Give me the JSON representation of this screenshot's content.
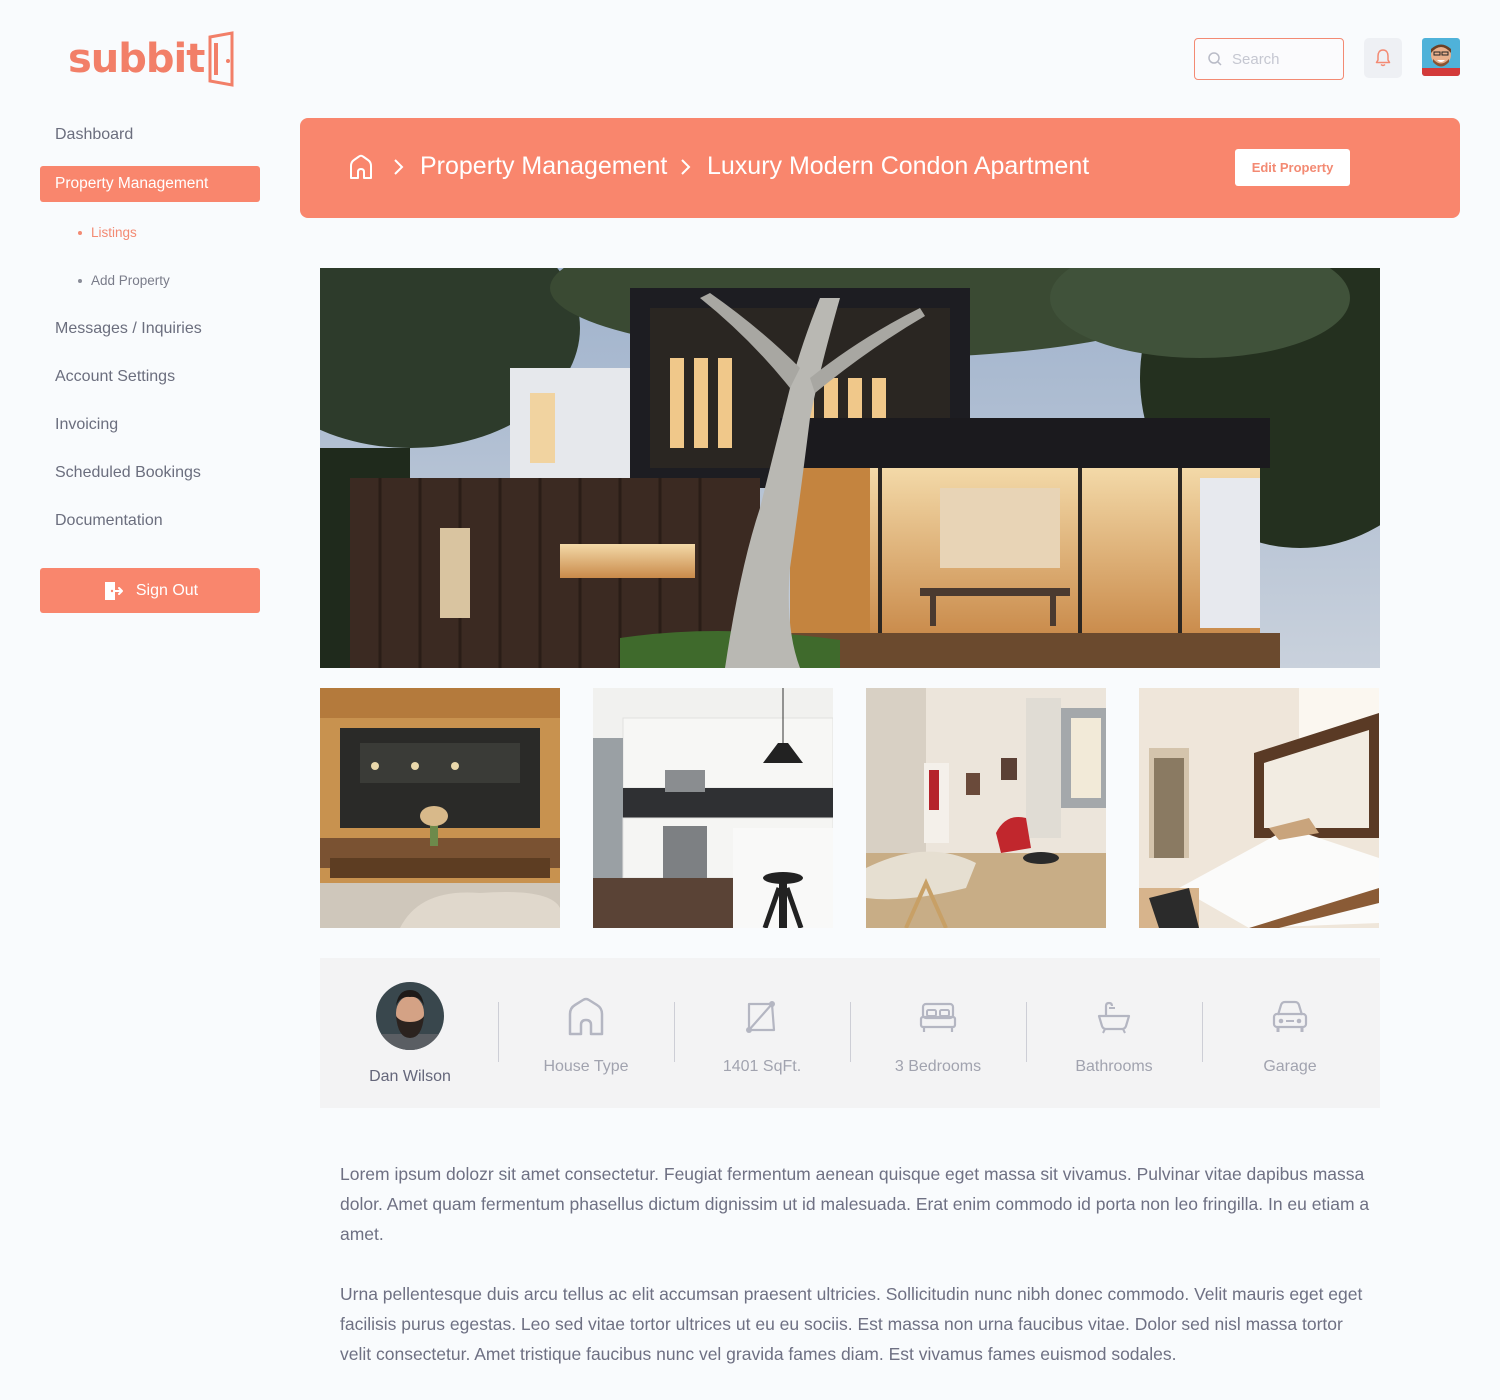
{
  "brand": {
    "name": "subbit"
  },
  "search": {
    "placeholder": "Search"
  },
  "sidebar": {
    "items": [
      {
        "label": "Dashboard"
      },
      {
        "label": "Property Management"
      },
      {
        "label": "Messages / Inquiries"
      },
      {
        "label": "Account Settings"
      },
      {
        "label": "Invoicing"
      },
      {
        "label": "Scheduled Bookings"
      },
      {
        "label": "Documentation"
      }
    ],
    "subitems": [
      {
        "label": "Listings"
      },
      {
        "label": "Add Property"
      }
    ],
    "signout_label": "Sign Out"
  },
  "breadcrumb": {
    "section": "Property Management",
    "page": "Luxury Modern Condon Apartment"
  },
  "header": {
    "edit_label": "Edit Property"
  },
  "agent": {
    "name": "Dan Wilson"
  },
  "features": [
    {
      "icon": "house-icon",
      "label": "House Type"
    },
    {
      "icon": "area-icon",
      "label": "1401 SqFt."
    },
    {
      "icon": "bed-icon",
      "label": "3 Bedrooms"
    },
    {
      "icon": "bathtub-icon",
      "label": "Bathrooms"
    },
    {
      "icon": "car-icon",
      "label": "Garage"
    }
  ],
  "description": [
    "Lorem ipsum dolozr sit amet consectetur. Feugiat fermentum aenean quisque eget massa sit vivamus. Pulvinar vitae dapibus massa dolor. Amet quam fermentum phasellus dictum dignissim ut id malesuada. Erat enim commodo id porta non leo fringilla. In eu etiam a amet.",
    "Urna pellentesque duis arcu tellus ac elit accumsan praesent ultricies. Sollicitudin nunc nibh donec commodo. Velit mauris eget eget facilisis purus egestas. Leo sed vitae tortor ultrices ut eu eu sociis. Est massa non urna faucibus vitae. Dolor sed nisl massa tortor velit consectetur. Amet tristique faucibus nunc vel gravida fames diam. Est vivamus fames euismod sodales."
  ],
  "colors": {
    "accent": "#f9866d",
    "accent_dark": "#f27f68",
    "text": "#6b6e7e",
    "muted": "#a1a3af"
  }
}
